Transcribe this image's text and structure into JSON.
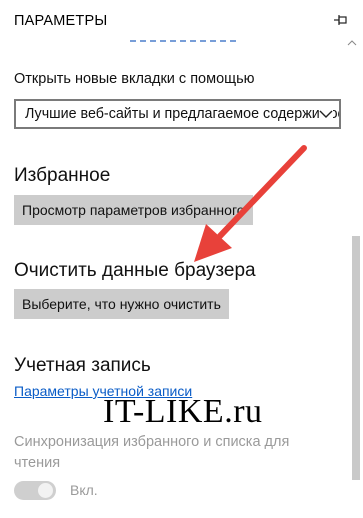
{
  "header": {
    "title": "ПАРАМЕТРЫ",
    "pin_icon": "pin-icon"
  },
  "new_tabs": {
    "label": "Открыть новые вкладки с помощью",
    "selected": "Лучшие веб-сайты и предлагаемое содержимое"
  },
  "favorites": {
    "title": "Избранное",
    "button": "Просмотр параметров избранного"
  },
  "clear_data": {
    "title": "Очистить данные браузера",
    "button": "Выберите, что нужно очистить"
  },
  "account": {
    "title": "Учетная запись",
    "link": "Параметры учетной записи",
    "sync_text": "Синхронизация избранного и списка для чтения",
    "toggle_label": "Вкл.",
    "toggle_on": true
  },
  "watermark": "IT-LIKE.ru",
  "colors": {
    "arrow": "#e8413a",
    "link": "#0a5cc7",
    "button_bg": "#cccccc"
  }
}
